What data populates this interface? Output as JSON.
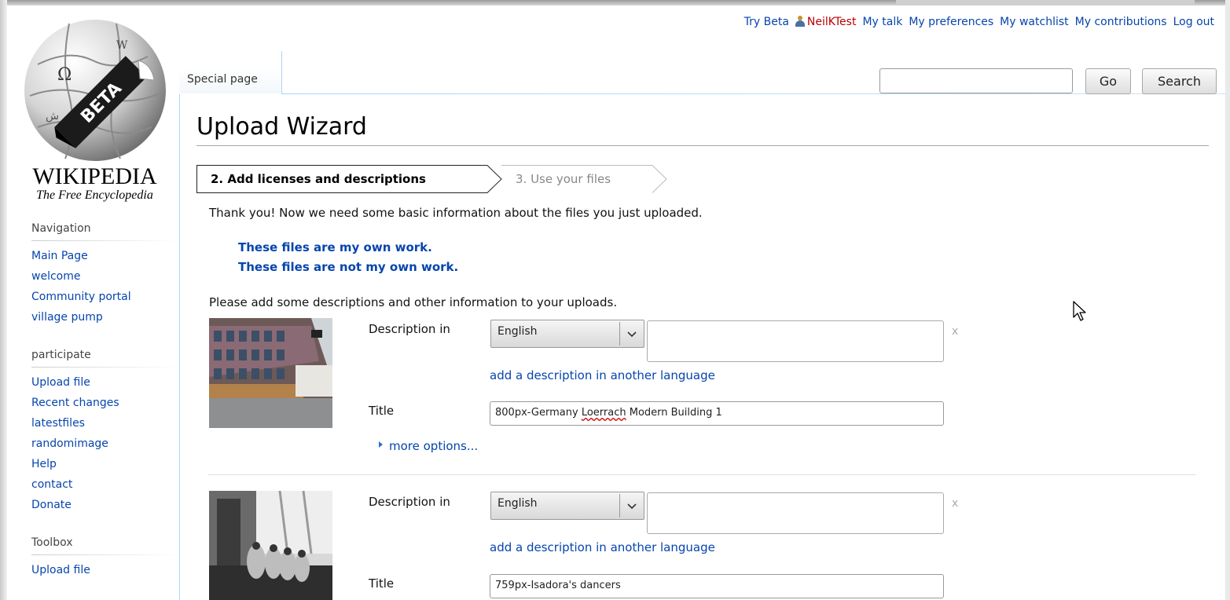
{
  "logo": {
    "beta_text": "BETA",
    "wordmark": "WIKIPEDIA",
    "tagline": "The Free Encyclopedia"
  },
  "personal_tools": {
    "try_beta": "Try Beta",
    "username": "NeilKTest",
    "my_talk": "My talk",
    "my_preferences": "My preferences",
    "my_watchlist": "My watchlist",
    "my_contributions": "My contributions",
    "log_out": "Log out"
  },
  "tabs": {
    "special_page": "Special page"
  },
  "search": {
    "value": "",
    "go_label": "Go",
    "search_label": "Search"
  },
  "sidebar": {
    "navigation": {
      "heading": "Navigation",
      "items": [
        "Main Page",
        "welcome",
        "Community portal",
        "village pump"
      ]
    },
    "participate": {
      "heading": "participate",
      "items": [
        "Upload file",
        "Recent changes",
        "latestfiles",
        "randomimage",
        "Help",
        "contact",
        "Donate"
      ]
    },
    "toolbox": {
      "heading": "Toolbox",
      "items": [
        "Upload file"
      ]
    }
  },
  "page": {
    "title": "Upload Wizard",
    "steps": {
      "active": "2. Add licenses and descriptions",
      "next": "3. Use your files"
    },
    "intro": "Thank you! Now we need some basic information about the files you just uploaded.",
    "own_work": "These files are my own work.",
    "not_own_work": "These files are not my own work.",
    "add_info": "Please add some descriptions and other information to your uploads."
  },
  "uploads": [
    {
      "description_label": "Description in",
      "language": "English",
      "description_value": "",
      "remove": "x",
      "add_language": "add a description in another language",
      "title_label": "Title",
      "title_prefix": "800px-Germany ",
      "title_misspelled": "Loerrach",
      "title_suffix": " Modern Building 1",
      "more_options": "more options..."
    },
    {
      "description_label": "Description in",
      "language": "English",
      "description_value": "",
      "remove": "x",
      "add_language": "add a description in another language",
      "title_label": "Title",
      "title_value": "759px-Isadora's dancers"
    }
  ],
  "colors": {
    "link": "#0645ad",
    "username": "#ba0000",
    "tab_border": "#a7d7f9"
  }
}
